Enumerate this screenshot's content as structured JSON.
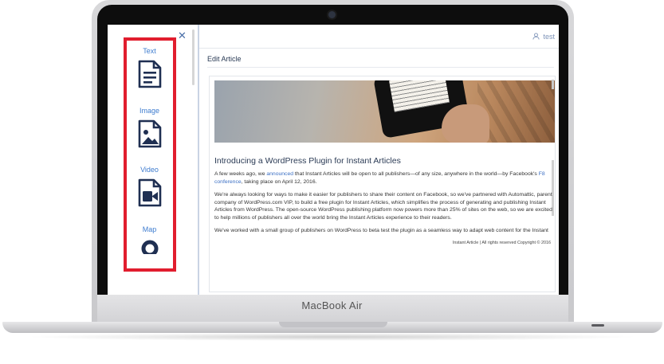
{
  "device": {
    "brand": "MacBook Air"
  },
  "panel": {
    "items": [
      {
        "label": "Text",
        "icon": "text-document-icon"
      },
      {
        "label": "Image",
        "icon": "image-document-icon"
      },
      {
        "label": "Video",
        "icon": "video-document-icon"
      },
      {
        "label": "Map",
        "icon": "map-pin-icon"
      }
    ],
    "close_icon": "close-icon"
  },
  "header": {
    "user_icon": "user-icon",
    "user_name": "test"
  },
  "editor": {
    "title": "Edit Article"
  },
  "article": {
    "title": "Introducing a WordPress Plugin for Instant Articles",
    "p1": {
      "before": "A few weeks ago, we ",
      "link1": "announced",
      "middle": " that Instant Articles will be open to all publishers—of any size, anywhere in the world—by Facebook's ",
      "link2": "F8 conference",
      "after": ", taking place on April 12, 2016."
    },
    "p2": "We're always looking for ways to make it easier for publishers to share their content on Facebook, so we've partnered with Automattic, parent company of WordPress.com VIP, to build a free plugin for Instant Articles, which simplifies the process of generating and publishing Instant Articles from WordPress. The open-source WordPress publishing platform now powers more than 25% of sites on the web, so we are excited to help millions of publishers all over the world bring the Instant Articles experience to their readers.",
    "p3": "We've worked with a small group of publishers on WordPress to beta test the plugin as a seamless way to adapt web content for the Instant",
    "footer": "Instant Article | All rights reserved Copyright © 2016"
  },
  "colors": {
    "accent": "#3e7ccf",
    "highlight": "#e11d2e",
    "icon": "#1f2f52"
  }
}
